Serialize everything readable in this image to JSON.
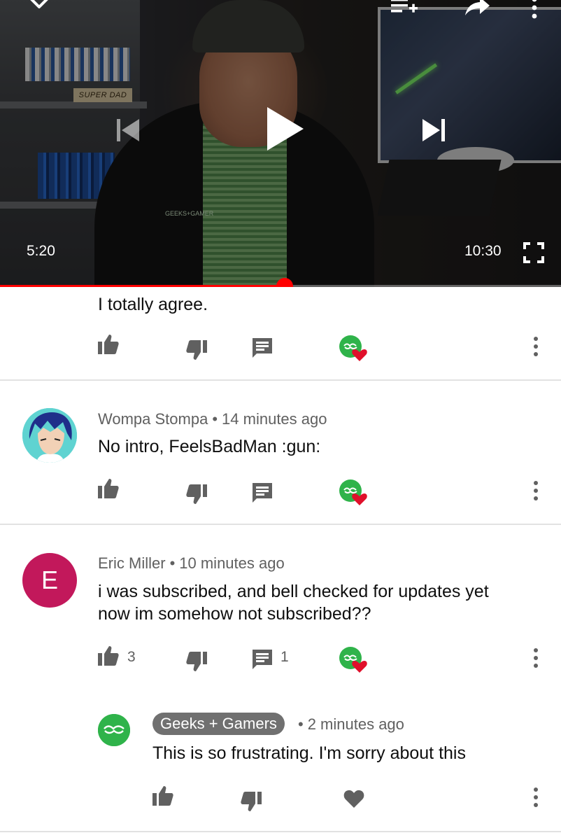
{
  "player": {
    "current_time": "5:20",
    "duration": "10:30",
    "progress_fraction": 0.507,
    "scene": {
      "sign_text": "SUPER DAD",
      "shirt_logo_text": "GEEKS+GAMER"
    }
  },
  "comments": [
    {
      "id": "partial",
      "text": "I totally agree."
    },
    {
      "id": "wompa",
      "author": "Wompa Stompa",
      "time": "14 minutes ago",
      "text": "No intro, FeelsBadMan :gun:"
    },
    {
      "id": "eric",
      "avatar_letter": "E",
      "author": "Eric Miller",
      "time": "10 minutes ago",
      "text_line1": "i was subscribed, and bell checked for updates yet",
      "text_line2": "now im somehow not subscribed??",
      "likes": "3",
      "replies": "1"
    }
  ],
  "reply": {
    "author": "Geeks + Gamers",
    "time": "2 minutes ago",
    "text": "This is so frustrating. I'm sorry about this"
  },
  "colors": {
    "accent_red": "#ff0000",
    "creator_green": "#2fb34a",
    "heart_red": "#e0102b",
    "avatar_e": "#c2185b",
    "icon_grey": "#606060"
  }
}
